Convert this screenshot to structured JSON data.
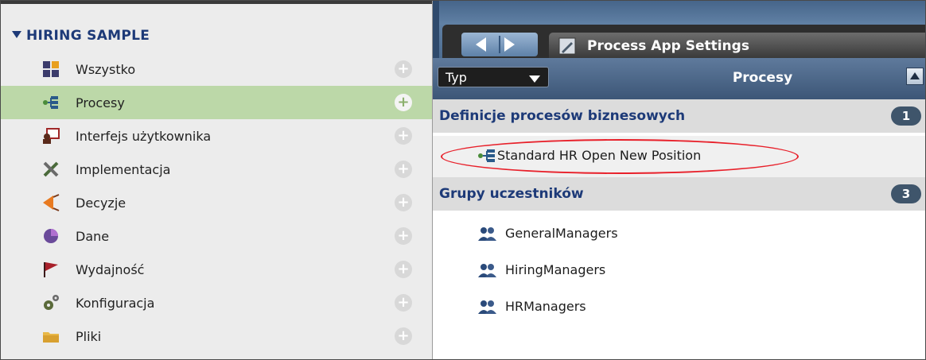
{
  "sidebar": {
    "title": "HIRING SAMPLE",
    "items": [
      {
        "label": "Wszystko",
        "icon": "all-tiles-icon"
      },
      {
        "label": "Procesy",
        "icon": "process-icon",
        "selected": true
      },
      {
        "label": "Interfejs użytkownika",
        "icon": "user-interface-icon"
      },
      {
        "label": "Implementacja",
        "icon": "tools-icon"
      },
      {
        "label": "Decyzje",
        "icon": "decision-icon"
      },
      {
        "label": "Dane",
        "icon": "data-icon"
      },
      {
        "label": "Wydajność",
        "icon": "flag-icon"
      },
      {
        "label": "Konfiguracja",
        "icon": "gears-icon"
      },
      {
        "label": "Pliki",
        "icon": "folder-icon"
      }
    ],
    "add_glyph": "+"
  },
  "header": {
    "tab_title": "Process App Settings"
  },
  "filter": {
    "type_value": "Typ",
    "title": "Procesy"
  },
  "sections": {
    "business_processes": {
      "title": "Definicje procesów biznesowych",
      "count": "1",
      "items": [
        "Standard HR Open New Position"
      ]
    },
    "participant_groups": {
      "title": "Grupy uczestników",
      "count": "3",
      "items": [
        "GeneralManagers",
        "HiringManagers",
        "HRManagers"
      ]
    }
  },
  "colors": {
    "selected_row": "#bcd8a8",
    "section_title": "#1d3a78",
    "highlight": "#e8202a"
  }
}
